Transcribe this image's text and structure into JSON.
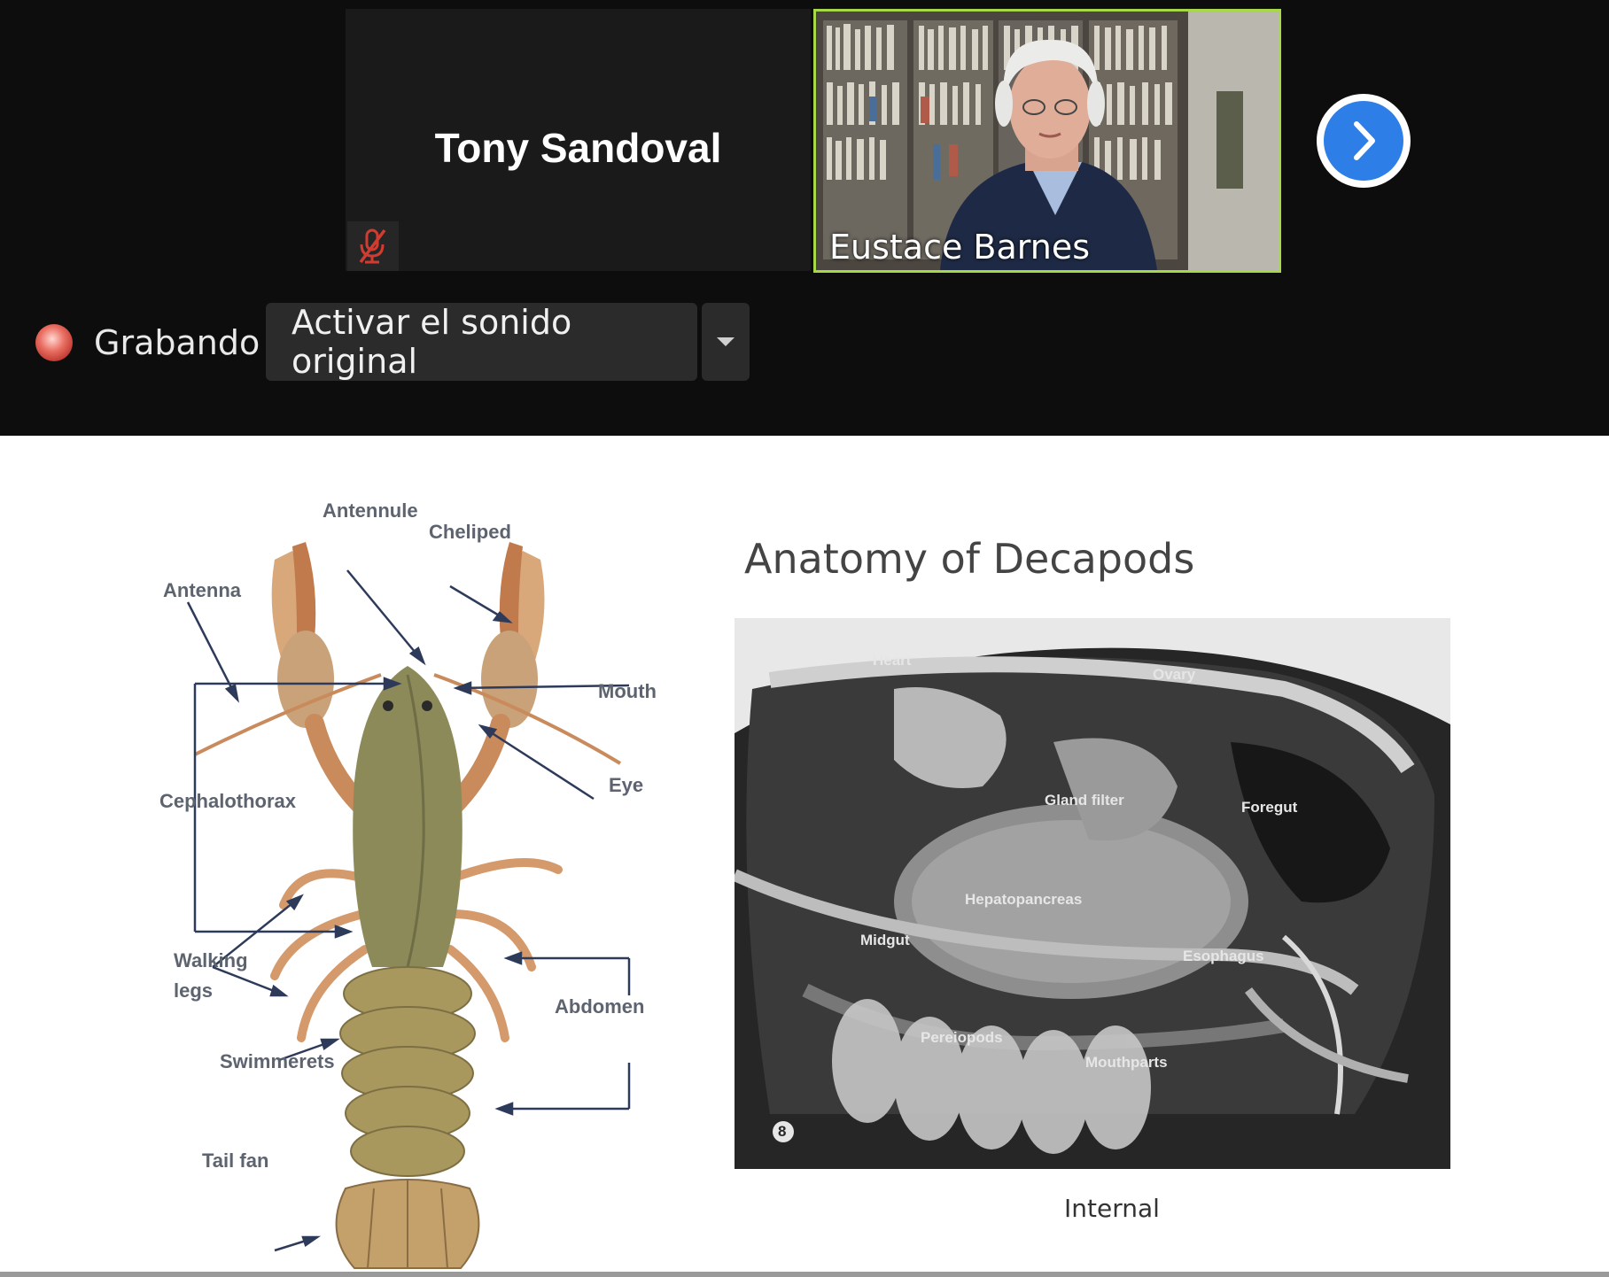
{
  "participants": {
    "audio_only": {
      "name": "Tony Sandoval",
      "muted_icon": "muted-microphone-icon"
    },
    "video": {
      "name": "Eustace Barnes",
      "active_speaker_color": "#a6d84a"
    }
  },
  "controls": {
    "next_icon": "chevron-right-icon",
    "recording_label": "Grabando",
    "original_sound_label": "Activar el sonido original",
    "dropdown_icon": "caret-down-icon",
    "accent": "#2d7ee6"
  },
  "slide": {
    "title": "Anatomy of Decapods",
    "external_labels": {
      "antennule": "Antennule",
      "cheliped": "Cheliped",
      "antenna": "Antenna",
      "mouth": "Mouth",
      "eye": "Eye",
      "cephalothorax": "Cephalothorax",
      "walking": "Walking",
      "legs": "legs",
      "abdomen": "Abdomen",
      "swimmerets": "Swimmerets",
      "tail_fan": "Tail fan"
    },
    "internal_labels": {
      "heart": "Heart",
      "ovary": "Ovary",
      "gland": "Gland filter",
      "foregut": "Foregut",
      "hepatopancreas": "Hepatopancreas",
      "midgut": "Midgut",
      "esophagus": "Esophagus",
      "pereiopods": "Pereiopods",
      "mouthparts": "Mouthparts",
      "plate_number": "8"
    },
    "caption": "Internal"
  }
}
